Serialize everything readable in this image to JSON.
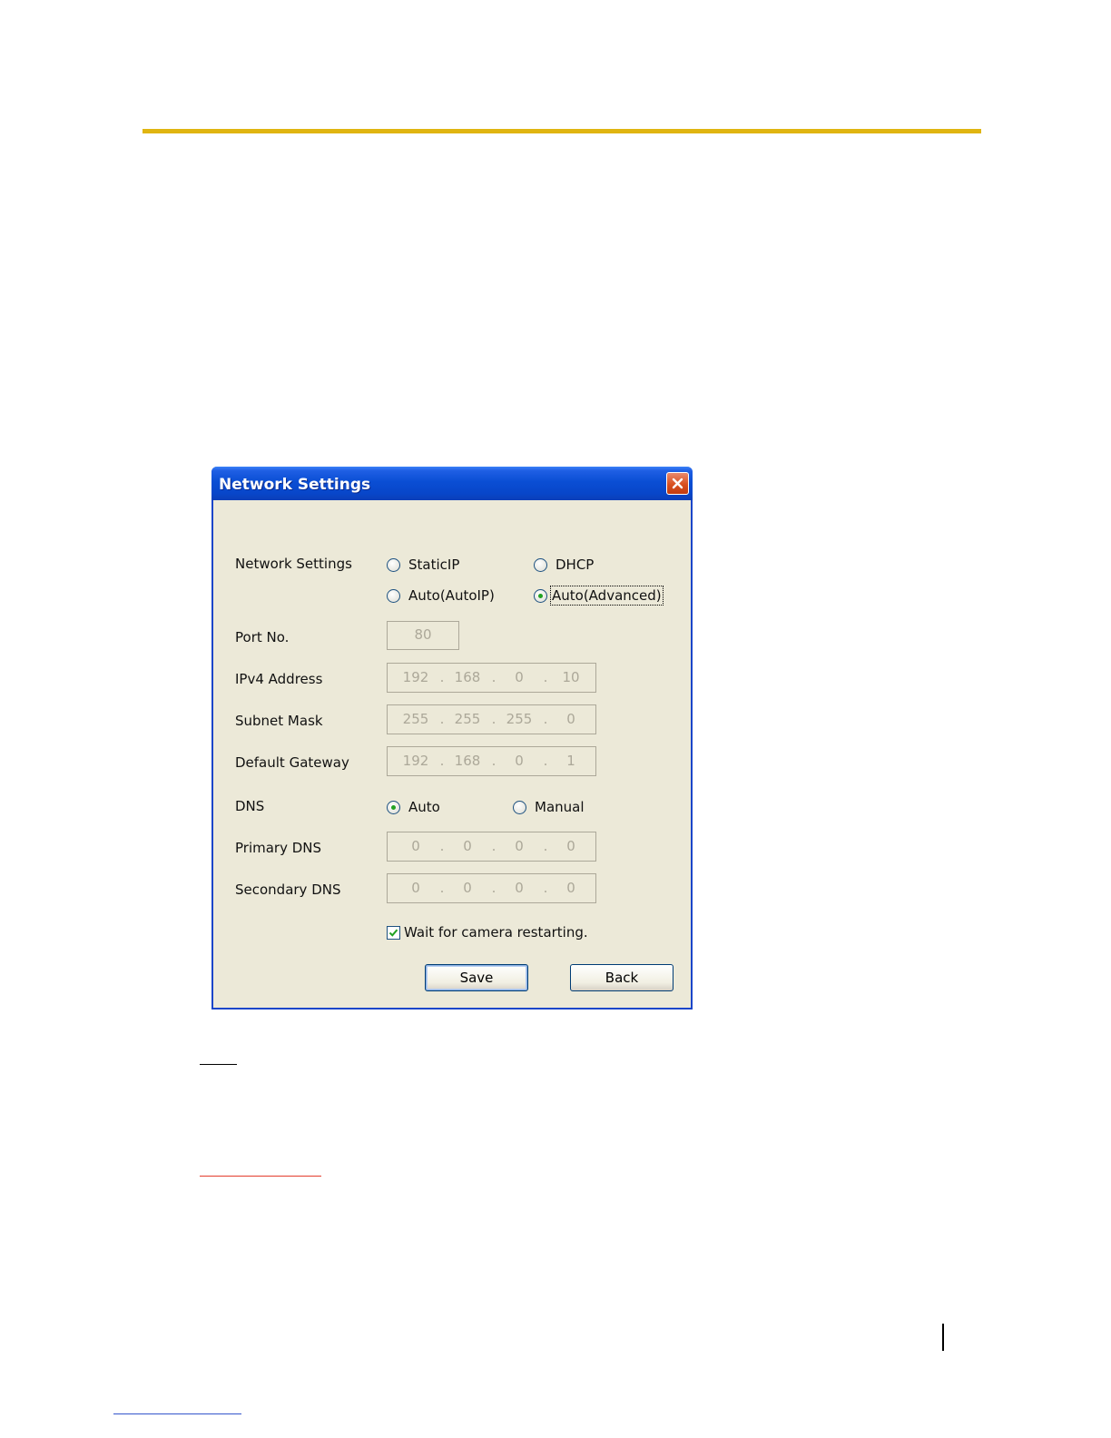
{
  "window": {
    "title": "Network Settings"
  },
  "network_settings": {
    "label": "Network Settings",
    "options": {
      "static_ip": "StaticIP",
      "dhcp": "DHCP",
      "auto_autoip": "Auto(AutoIP)",
      "auto_advanced": "Auto(Advanced)"
    },
    "selected": "Auto(Advanced)"
  },
  "port": {
    "label": "Port No.",
    "value": "80"
  },
  "ipv4": {
    "label": "IPv4 Address",
    "octets": [
      "192",
      "168",
      "0",
      "10"
    ]
  },
  "subnet": {
    "label": "Subnet Mask",
    "octets": [
      "255",
      "255",
      "255",
      "0"
    ]
  },
  "gateway": {
    "label": "Default Gateway",
    "octets": [
      "192",
      "168",
      "0",
      "1"
    ]
  },
  "dns": {
    "label": "DNS",
    "options": {
      "auto": "Auto",
      "manual": "Manual"
    },
    "selected": "Auto"
  },
  "primary_dns": {
    "label": "Primary DNS",
    "octets": [
      "0",
      "0",
      "0",
      "0"
    ]
  },
  "secondary_dns": {
    "label": "Secondary DNS",
    "octets": [
      "0",
      "0",
      "0",
      "0"
    ]
  },
  "wait_restart": {
    "label": "Wait for camera restarting.",
    "checked": true
  },
  "buttons": {
    "save": "Save",
    "back": "Back"
  },
  "colors": {
    "title_bar": "#0a4ed4",
    "dialog_bg": "#ece9d8",
    "page_rule": "#e0b511",
    "close_button": "#d9501f",
    "radio_dot": "#21a121"
  }
}
